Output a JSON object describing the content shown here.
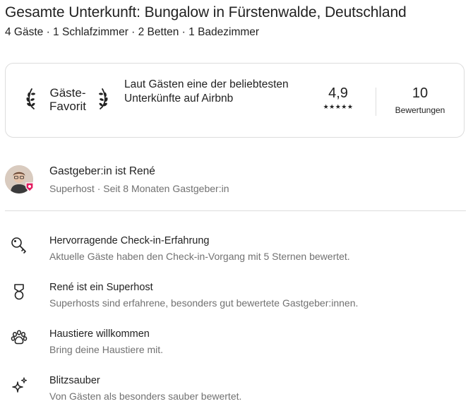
{
  "header": {
    "title": "Gesamte Unterkunft: Bungalow in Fürstenwalde, Deutschland",
    "summary": "4 Gäste · 1 Schlafzimmer · 2 Betten · 1 Badezimmer"
  },
  "favorite": {
    "badge_line1": "Gäste-",
    "badge_line2": "Favorit",
    "description": "Laut Gästen eine der beliebtesten Unterkünfte auf Airbnb",
    "rating": "4,9",
    "stars": "★★★★★",
    "reviews_count": "10",
    "reviews_label": "Bewertungen"
  },
  "host": {
    "name": "Gastgeber:in ist René",
    "subtitle": "Superhost · Seit 8 Monaten Gastgeber:in",
    "badge_color": "#e31c5f"
  },
  "features": [
    {
      "icon": "key-icon",
      "title": "Hervorragende Check-in-Erfahrung",
      "description": "Aktuelle Gäste haben den Check-in-Vorgang mit 5 Sternen bewertet."
    },
    {
      "icon": "medal-icon",
      "title": "René ist ein Superhost",
      "description": "Superhosts sind erfahrene, besonders gut bewertete Gastgeber:innen."
    },
    {
      "icon": "paw-icon",
      "title": "Haustiere willkommen",
      "description": "Bring deine Haustiere mit."
    },
    {
      "icon": "sparkles-icon",
      "title": "Blitzsauber",
      "description": "Von Gästen als besonders sauber bewertet."
    }
  ]
}
